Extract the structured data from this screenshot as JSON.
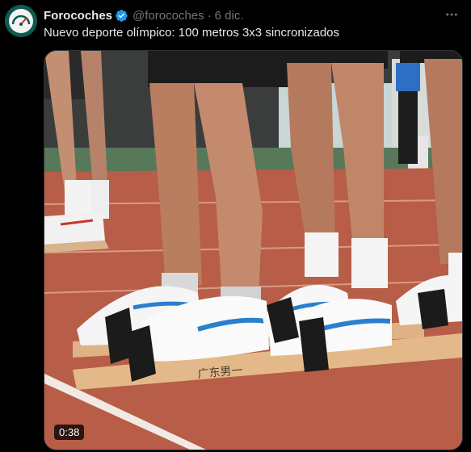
{
  "tweet": {
    "author_name": "Forocoches",
    "author_handle": "@forocoches",
    "separator": "·",
    "date": "6 dic.",
    "text": "Nuevo deporte olímpico: 100 metros 3x3 sincronizados",
    "verified": true
  },
  "media": {
    "type": "video",
    "duration": "0:38",
    "board_inscription": "广东男一"
  },
  "icons": {
    "verified": "verified-badge-icon",
    "more": "more-dots-icon"
  },
  "colors": {
    "text_primary": "#e7e9ea",
    "text_secondary": "#71767b",
    "verified_blue": "#1d9bf0",
    "background": "#000000"
  }
}
